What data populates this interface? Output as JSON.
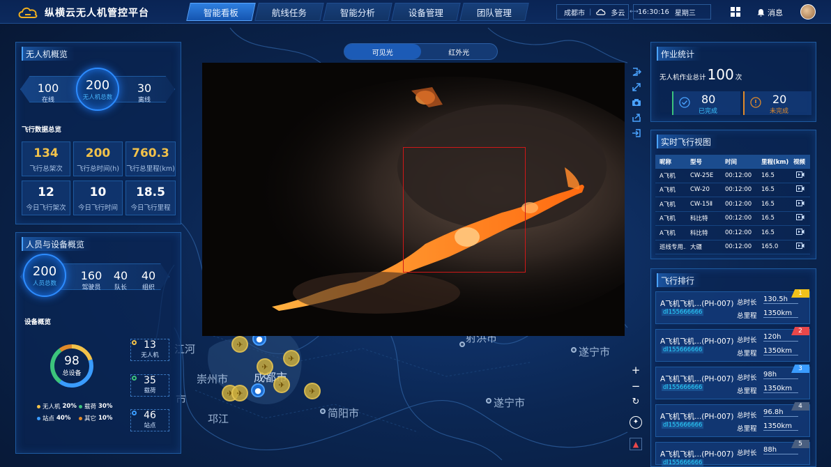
{
  "app": {
    "title": "纵横云无人机管控平台"
  },
  "nav": [
    "智能看板",
    "航线任务",
    "智能分析",
    "设备管理",
    "团队管理"
  ],
  "header": {
    "city": "成都市",
    "weather": "多云",
    "time": "16:30:16",
    "weekday": "星期三",
    "messages": "消息"
  },
  "colors": {
    "accent": "#2e7fe0",
    "gold": "#f2c24a",
    "fire": "#ff8a2a",
    "red_box": "#d01818"
  },
  "map": {
    "labels": [
      "成都市",
      "崇州市",
      "简阳市",
      "遂宁市",
      "遂宁市",
      "射洪市",
      "邛江",
      "江河",
      "市"
    ]
  },
  "uav_overview": {
    "title": "无人机概览",
    "online_value": "100",
    "online_label": "在线",
    "total_value": "200",
    "total_label": "无人机总数",
    "offline_value": "30",
    "offline_label": "离线"
  },
  "flight_data": {
    "title": "飞行数据总览",
    "cells": [
      {
        "value": "134",
        "label": "飞行总架次"
      },
      {
        "value": "200",
        "label": "飞行总时间(h)"
      },
      {
        "value": "760.3",
        "label": "飞行总里程(km)"
      },
      {
        "value": "12",
        "label": "今日飞行架次"
      },
      {
        "value": "10",
        "label": "今日飞行时间"
      },
      {
        "value": "18.5",
        "label": "今日飞行里程"
      }
    ]
  },
  "personnel": {
    "title": "人员与设备概览",
    "total_value": "200",
    "total_label": "人员总数",
    "items": [
      {
        "value": "160",
        "label": "驾驶员"
      },
      {
        "value": "40",
        "label": "队长"
      },
      {
        "value": "40",
        "label": "组织"
      }
    ]
  },
  "devices": {
    "title": "设备概览",
    "total_value": "98",
    "total_label": "总设备",
    "legend": [
      {
        "label": "无人机",
        "pct": "20%",
        "color": "#f2c24a"
      },
      {
        "label": "载荷",
        "pct": "30%",
        "color": "#3cc47c"
      },
      {
        "label": "站点",
        "pct": "40%",
        "color": "#3a9cff"
      },
      {
        "label": "其它",
        "pct": "10%",
        "color": "#e08a2a"
      }
    ],
    "boxes": [
      {
        "value": "13",
        "label": "无人机",
        "color": "#f2c24a"
      },
      {
        "value": "35",
        "label": "载荷",
        "color": "#3cc47c"
      },
      {
        "value": "46",
        "label": "站点",
        "color": "#3a9cff"
      }
    ]
  },
  "video": {
    "tabs": [
      "可见光",
      "红外光"
    ]
  },
  "work_stats": {
    "title": "作业统计",
    "total_prefix": "无人机作业总计",
    "total_value": "100",
    "total_unit": "次",
    "done_value": "80",
    "done_label": "已完成",
    "undone_value": "20",
    "undone_label": "未完成"
  },
  "live_view": {
    "title": "实时飞行视图",
    "headers": [
      "昵称",
      "型号",
      "时间",
      "里程(km)",
      "视频"
    ],
    "rows": [
      [
        "A飞机",
        "CW-25E",
        "00:12:00",
        "16.5"
      ],
      [
        "A飞机",
        "CW-20",
        "00:12:00",
        "16.5"
      ],
      [
        "A飞机",
        "CW-15Ⅱ",
        "00:12:00",
        "16.5"
      ],
      [
        "A飞机",
        "科比特",
        "00:12:00",
        "16.5"
      ],
      [
        "A飞机",
        "科比特",
        "00:12:00",
        "16.5"
      ],
      [
        "巡线专用...",
        "大疆",
        "00:12:00",
        "165.0"
      ]
    ]
  },
  "ranking": {
    "title": "飞行排行",
    "duration_label": "总时长",
    "mileage_label": "总里程",
    "items": [
      {
        "rank": "1",
        "name": "A飞机飞机...(PH-007)",
        "serial": "dl155666666",
        "duration": "130.5h",
        "mileage": "1350km",
        "color": "#f2c21a"
      },
      {
        "rank": "2",
        "name": "A飞机飞机...(PH-007)",
        "serial": "dl155666666",
        "duration": "120h",
        "mileage": "1350km",
        "color": "#e8474a"
      },
      {
        "rank": "3",
        "name": "A飞机飞机...(PH-007)",
        "serial": "dl155666666",
        "duration": "98h",
        "mileage": "1350km",
        "color": "#3a9cff"
      },
      {
        "rank": "4",
        "name": "A飞机飞机...(PH-007)",
        "serial": "dl155666666",
        "duration": "96.8h",
        "mileage": "1350km",
        "color": "#4a5f80"
      },
      {
        "rank": "5",
        "name": "A飞机飞机...(PH-007)",
        "serial": "dl155666666",
        "duration": "88h",
        "mileage": "",
        "color": "#4a5f80"
      }
    ]
  }
}
